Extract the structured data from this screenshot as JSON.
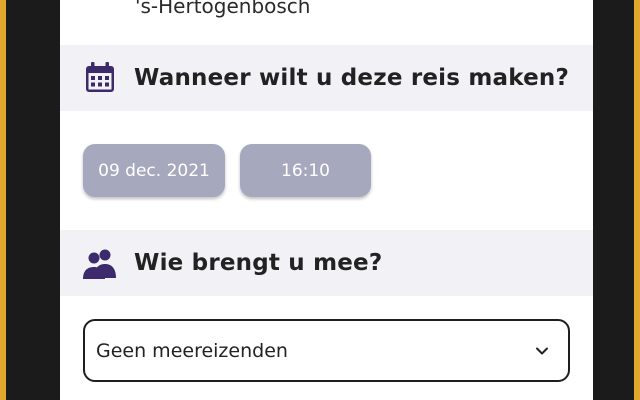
{
  "route": {
    "destination_partial": "'s-Hertogenbosch"
  },
  "when_section": {
    "title": "Wanneer wilt u deze reis maken?",
    "icon": "calendar-icon",
    "date_value": "09 dec. 2021",
    "time_value": "16:10"
  },
  "who_section": {
    "title": "Wie brengt u mee?",
    "icon": "people-icon",
    "companions_selected": "Geen meereizenden"
  },
  "colors": {
    "background_frame": "#e0a92b",
    "section_header_bg": "#f2f2f6",
    "icon_purple": "#3d2a6c",
    "chip_bg": "#a6a9bd"
  }
}
